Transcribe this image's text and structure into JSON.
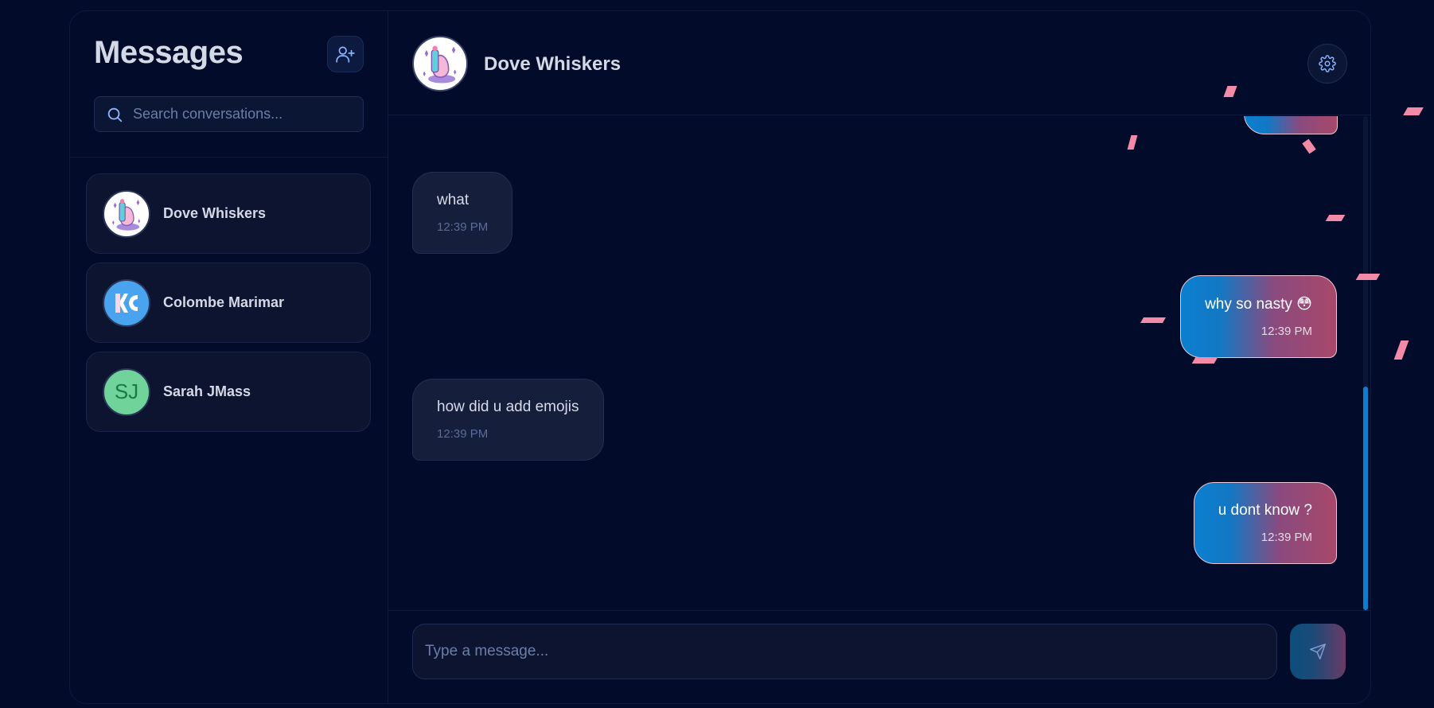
{
  "sidebar": {
    "title": "Messages",
    "add_icon": "user-plus-icon",
    "search": {
      "placeholder": "Search conversations...",
      "icon": "search-icon"
    },
    "conversations": [
      {
        "name": "Dove Whiskers",
        "avatar": "dove-whiskers-avatar"
      },
      {
        "name": "Colombe Marimar",
        "avatar": "colombe-marimar-avatar"
      },
      {
        "name": "Sarah JMass",
        "avatar_initials": "SJ"
      }
    ]
  },
  "chat": {
    "contact_name": "Dove Whiskers",
    "settings_icon": "gear-icon",
    "messages": [
      {
        "direction": "in",
        "text": "what",
        "time": "12:39 PM"
      },
      {
        "direction": "out",
        "text": "why so nasty 😳",
        "time": "12:39 PM"
      },
      {
        "direction": "in",
        "text": "how did u add emojis",
        "time": "12:39 PM"
      },
      {
        "direction": "out",
        "text": "u dont know ?",
        "time": "12:39 PM"
      }
    ],
    "composer": {
      "placeholder": "Type a message...",
      "send_icon": "send-icon"
    }
  },
  "colors": {
    "background": "#020b2a",
    "accent_blue": "#0a7fd0",
    "accent_pink": "#a8486a",
    "confetti": "#f28aa8"
  }
}
